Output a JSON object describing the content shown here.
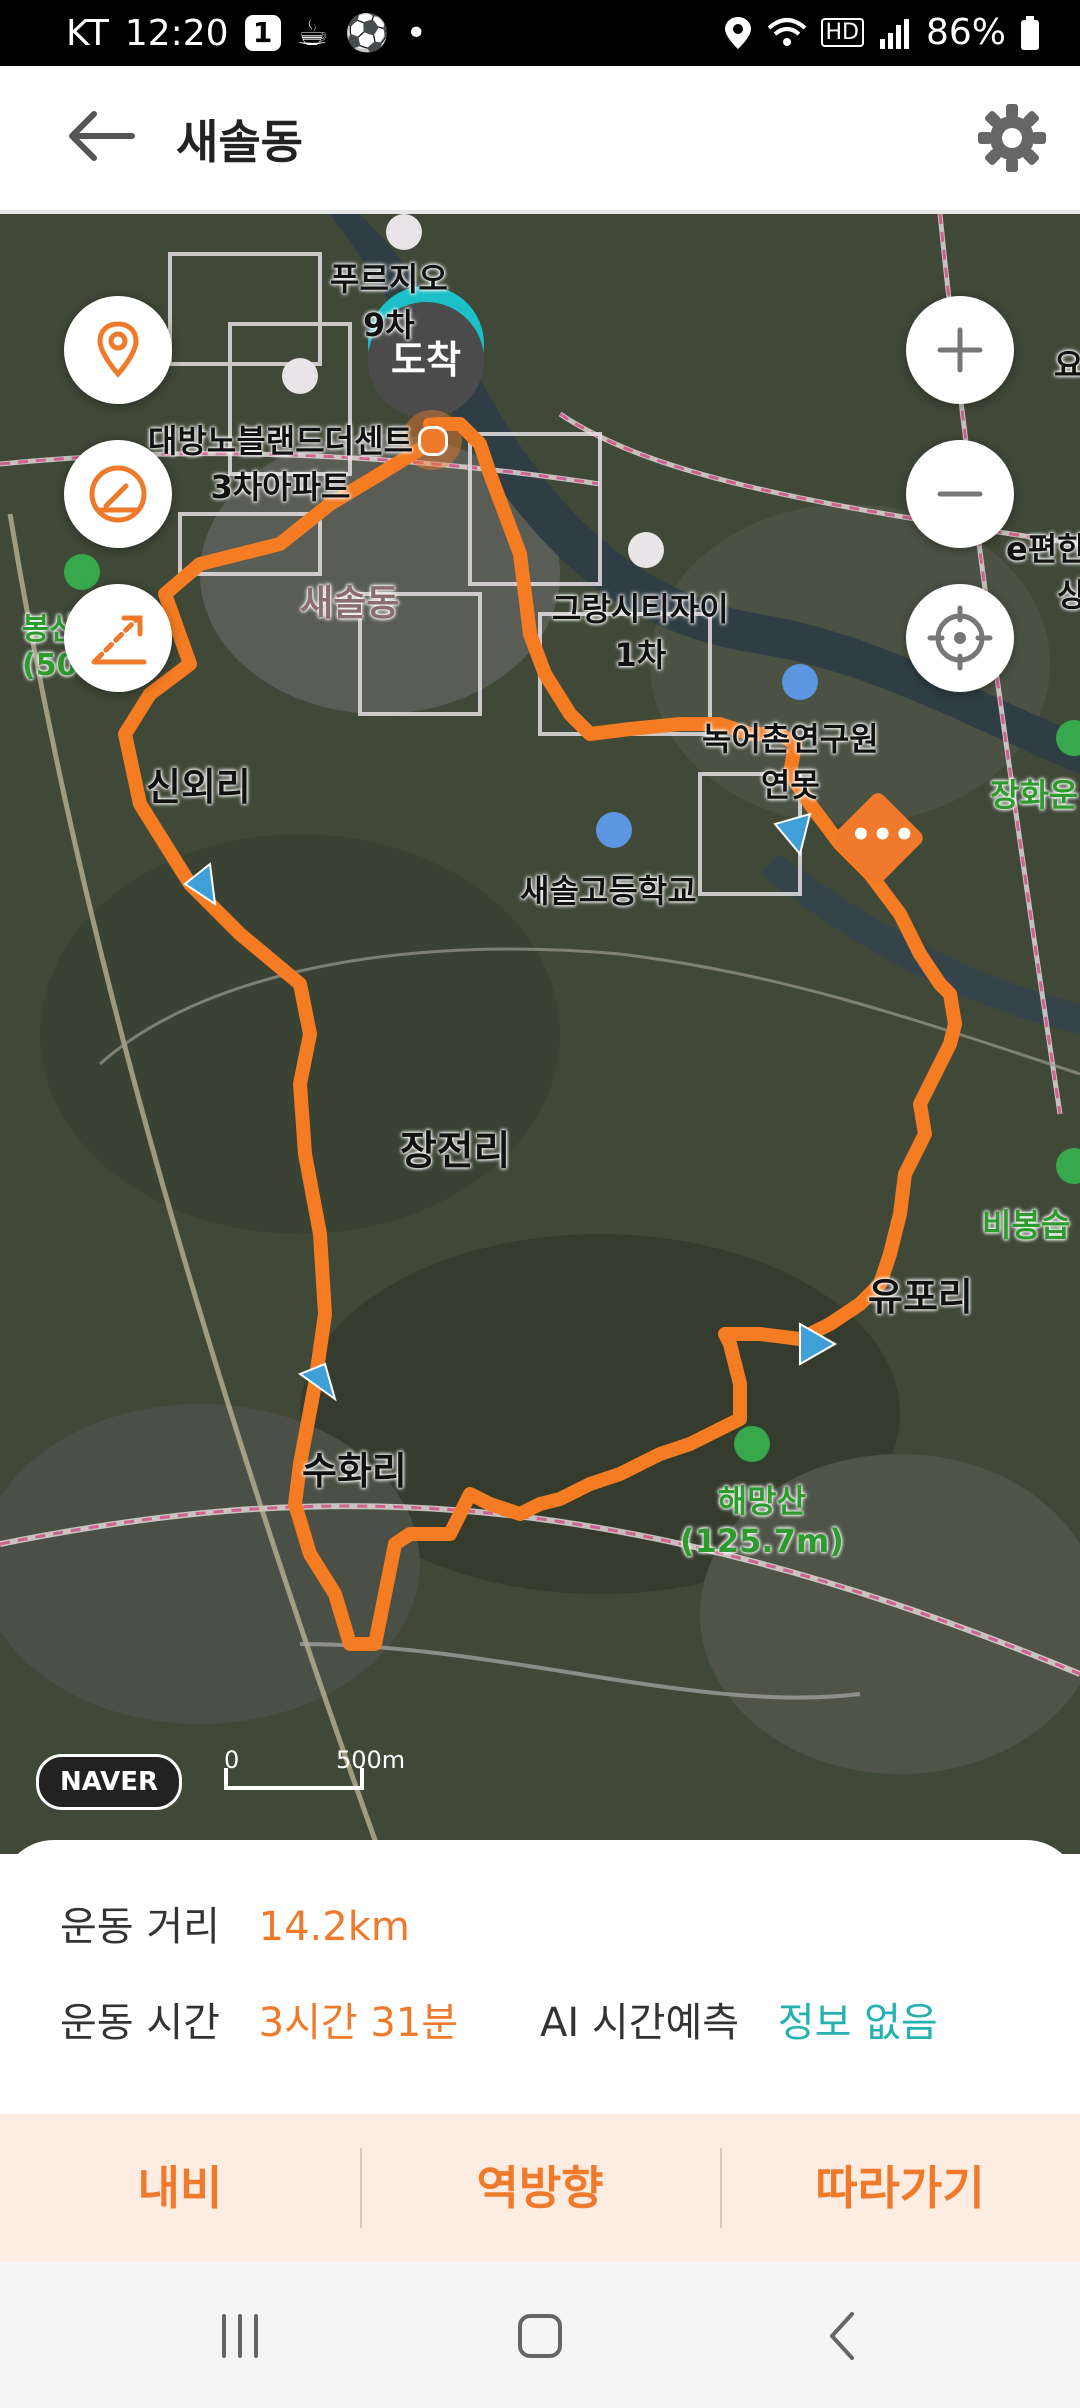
{
  "status_bar": {
    "carrier": "KT",
    "time": "12:20",
    "badge": "1",
    "hd": "HD",
    "battery": "86%"
  },
  "header": {
    "title": "새솔동"
  },
  "map": {
    "labels": {
      "purgio": "푸르지오\n9차",
      "daebang": "대방노블랜드더센트\n3차아파트",
      "saesol_dong": "새솔동",
      "bongsan": "봉산\n(50.",
      "grang": "그랑시티자이\n1차",
      "nongeochon": "녹어촌연구원\n연못",
      "sinoeri": "신외리",
      "school": "새솔고등학교",
      "jangjeonri": "장전리",
      "upori": "유포리",
      "suhwari": "수화리",
      "haemangsan": "해망산\n(125.7m)",
      "epyeon": "e편한\n상",
      "jangwha": "장화운",
      "bibong": "비봉습",
      "yo": "요"
    },
    "arrival": "도착",
    "provider": "NAVER",
    "scale_zero": "0",
    "scale_label": "500m"
  },
  "summary": {
    "distance_label": "운동 거리",
    "distance_value": "14.2km",
    "time_label": "운동 시간",
    "time_value": "3시간 31분",
    "ai_label": "AI 시간예측",
    "ai_value": "정보 없음"
  },
  "actions": {
    "navi": "내비",
    "reverse": "역방향",
    "follow": "따라가기"
  },
  "colors": {
    "accent": "#f07a2c",
    "teal": "#26b1b1",
    "route": "#f57c22",
    "action_bg": "#fdece1"
  }
}
